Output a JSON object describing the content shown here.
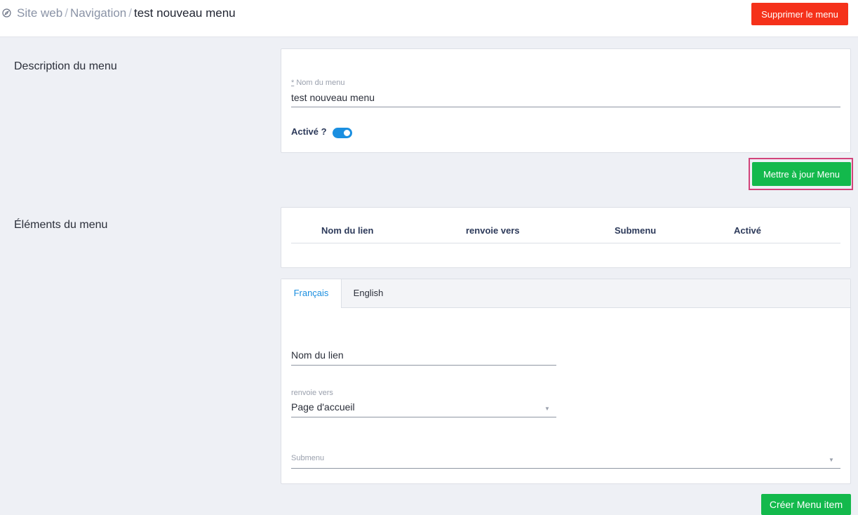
{
  "breadcrumb": {
    "icon": "compass-icon",
    "items": [
      "Site web",
      "Navigation"
    ],
    "separator": "/",
    "current": "test nouveau menu"
  },
  "actions": {
    "delete_label": "Supprimer le menu",
    "update_label": "Mettre à jour Menu",
    "create_label": "Créer Menu item"
  },
  "description": {
    "section_title": "Description du menu",
    "required_marker": "*",
    "name_label": "Nom du menu",
    "name_value": "test nouveau menu",
    "active_label": "Activé ?",
    "active_on": true
  },
  "elements": {
    "section_title": "Éléments du menu",
    "columns": [
      "Nom du lien",
      "renvoie vers",
      "Submenu",
      "Activé"
    ],
    "rows": []
  },
  "item_form": {
    "tabs": [
      {
        "label": "Français",
        "active": true
      },
      {
        "label": "English",
        "active": false
      }
    ],
    "link_name_placeholder": "Nom du lien",
    "target_label": "renvoie vers",
    "target_value": "Page d'accueil",
    "submenu_placeholder": "Submenu"
  },
  "colors": {
    "danger": "#f5311a",
    "success": "#13b94c",
    "accent": "#1b8fe0",
    "highlight_border": "#d2437a"
  }
}
